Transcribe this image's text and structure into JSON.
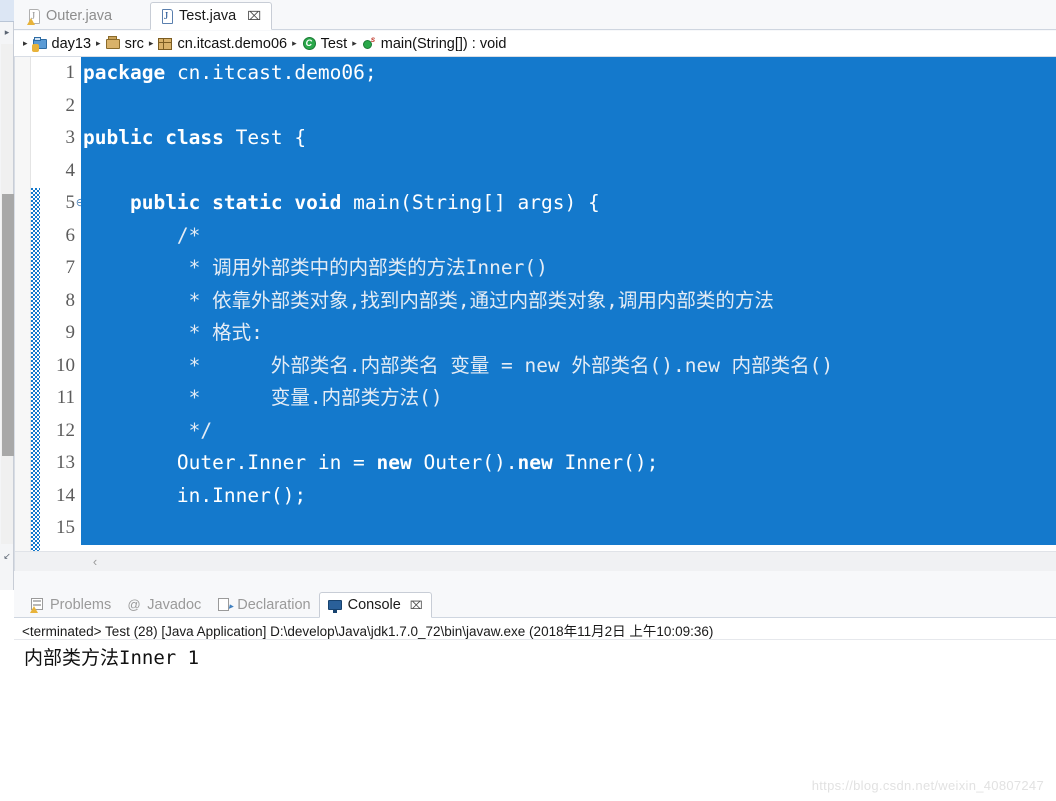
{
  "app": {
    "watermark": "https://blog.csdn.net/weixin_40807247"
  },
  "editor": {
    "tabs": [
      {
        "label": "Outer.java",
        "icon": "java-file-warning-icon",
        "active": false,
        "closable": false
      },
      {
        "label": "Test.java",
        "icon": "java-file-icon",
        "active": true,
        "closable": true,
        "close": "⌧"
      }
    ],
    "breadcrumb": [
      {
        "label": "day13",
        "icon": "java-project-icon"
      },
      {
        "label": "src",
        "icon": "source-folder-icon"
      },
      {
        "label": "cn.itcast.demo06",
        "icon": "package-icon"
      },
      {
        "label": "Test",
        "icon": "class-icon",
        "glyph": "C"
      },
      {
        "label": "main(String[]) : void",
        "icon": "method-icon",
        "glyph": "s"
      }
    ],
    "separator": "▸",
    "line_numbers": [
      "1",
      "2",
      "3",
      "4",
      "5",
      "6",
      "7",
      "8",
      "9",
      "10",
      "11",
      "12",
      "13",
      "14",
      "15"
    ],
    "fold_marker_line": 5,
    "fold_glyph": "⊖",
    "selection_color": "#1479cc",
    "selection_text_color": "#ffffff",
    "code_lines": [
      {
        "n": 1,
        "text": "package cn.itcast.demo06;"
      },
      {
        "n": 2,
        "text": ""
      },
      {
        "n": 3,
        "text": "public class Test {"
      },
      {
        "n": 4,
        "text": ""
      },
      {
        "n": 5,
        "text": "    public static void main(String[] args) {"
      },
      {
        "n": 6,
        "text": "        /*"
      },
      {
        "n": 7,
        "text": "         * 调用外部类中的内部类的方法Inner()"
      },
      {
        "n": 8,
        "text": "         * 依靠外部类对象,找到内部类,通过内部类对象,调用内部类的方法"
      },
      {
        "n": 9,
        "text": "         * 格式:"
      },
      {
        "n": 10,
        "text": "         *      外部类名.内部类名 变量 = new 外部类名().new 内部类名()"
      },
      {
        "n": 11,
        "text": "         *      变量.内部类方法()"
      },
      {
        "n": 12,
        "text": "         */"
      },
      {
        "n": 13,
        "text": "        Outer.Inner in = new Outer().new Inner();"
      },
      {
        "n": 14,
        "text": "        in.Inner();"
      },
      {
        "n": 15,
        "text": ""
      }
    ],
    "hscroll_left_arrow": "‹"
  },
  "bottom_panel": {
    "tabs": [
      {
        "label": "Problems",
        "icon": "problems-icon",
        "active": false
      },
      {
        "label": "Javadoc",
        "icon": "javadoc-icon",
        "active": false
      },
      {
        "label": "Declaration",
        "icon": "declaration-icon",
        "active": false
      },
      {
        "label": "Console",
        "icon": "console-icon",
        "active": true,
        "close": "⌧"
      }
    ],
    "console": {
      "status": "<terminated> Test (28) [Java Application] D:\\develop\\Java\\jdk1.7.0_72\\bin\\javaw.exe (2018年11月2日 上午10:09:36)",
      "output": [
        "内部类方法Inner 1"
      ]
    }
  },
  "left_strip": {
    "up_arrow": "▸",
    "down_arrow": "↙"
  }
}
